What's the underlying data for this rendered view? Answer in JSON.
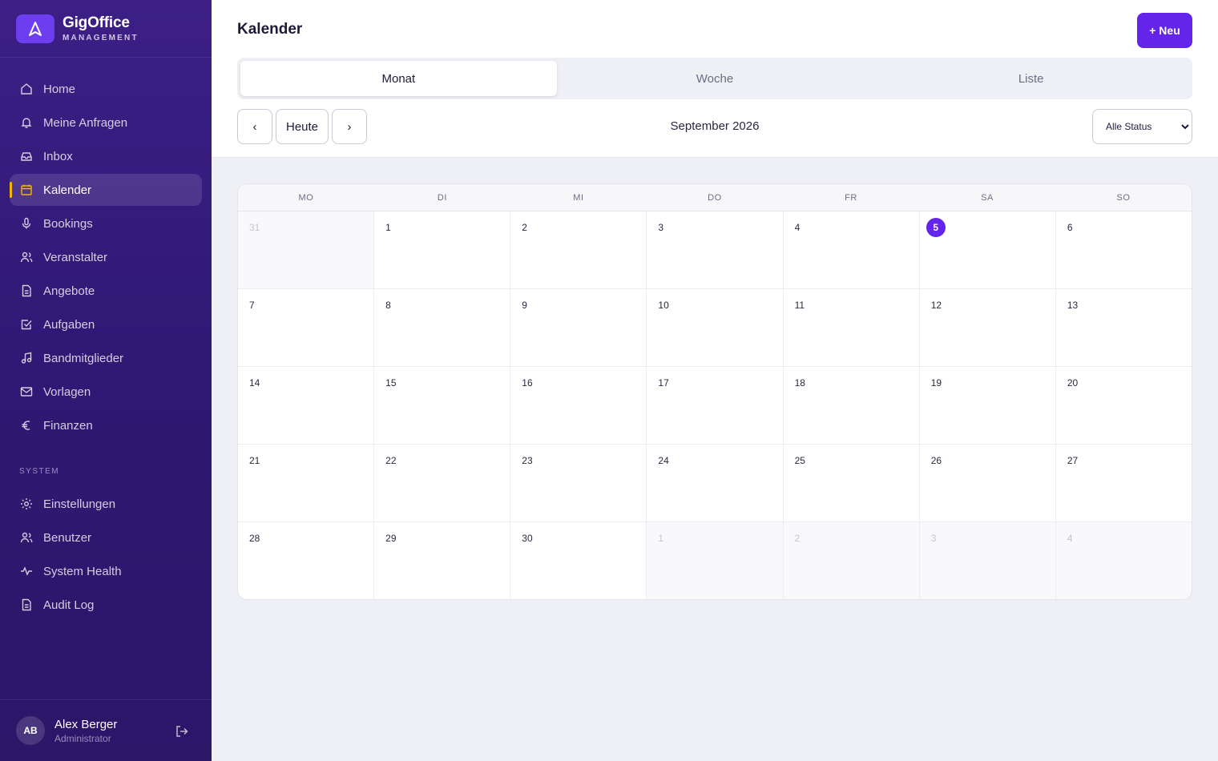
{
  "brand": {
    "name": "GigOffice",
    "subtitle": "MANAGEMENT"
  },
  "sidebar": {
    "items": [
      {
        "label": "Home",
        "icon": "home-icon",
        "active": false
      },
      {
        "label": "Meine Anfragen",
        "icon": "bell-icon",
        "active": false
      },
      {
        "label": "Inbox",
        "icon": "inbox-icon",
        "active": false
      },
      {
        "label": "Kalender",
        "icon": "calendar-icon",
        "active": true
      },
      {
        "label": "Bookings",
        "icon": "microphone-icon",
        "active": false
      },
      {
        "label": "Veranstalter",
        "icon": "users-icon",
        "active": false
      },
      {
        "label": "Angebote",
        "icon": "document-icon",
        "active": false
      },
      {
        "label": "Aufgaben",
        "icon": "checkbox-icon",
        "active": false
      },
      {
        "label": "Bandmitglieder",
        "icon": "music-note-icon",
        "active": false
      },
      {
        "label": "Vorlagen",
        "icon": "mail-icon",
        "active": false
      },
      {
        "label": "Finanzen",
        "icon": "euro-icon",
        "active": false
      }
    ],
    "system_label": "SYSTEM",
    "system_items": [
      {
        "label": "Einstellungen",
        "icon": "gear-icon"
      },
      {
        "label": "Benutzer",
        "icon": "users-icon"
      },
      {
        "label": "System Health",
        "icon": "pulse-icon"
      },
      {
        "label": "Audit Log",
        "icon": "document-icon"
      }
    ]
  },
  "user": {
    "initials": "AB",
    "name": "Alex Berger",
    "role": "Administrator"
  },
  "header": {
    "title": "Kalender",
    "new_button": "+ Neu"
  },
  "tabs": [
    {
      "label": "Monat",
      "active": true
    },
    {
      "label": "Woche",
      "active": false
    },
    {
      "label": "Liste",
      "active": false
    }
  ],
  "toolbar": {
    "prev": "‹",
    "today": "Heute",
    "next": "›",
    "month": "September 2026",
    "status_filter": "Alle Status"
  },
  "calendar": {
    "weekdays": [
      "MO",
      "DI",
      "MI",
      "DO",
      "FR",
      "SA",
      "SO"
    ],
    "today": 5,
    "weeks": [
      [
        {
          "d": "31",
          "out": true
        },
        {
          "d": "1"
        },
        {
          "d": "2"
        },
        {
          "d": "3"
        },
        {
          "d": "4"
        },
        {
          "d": "5",
          "today": true
        },
        {
          "d": "6"
        }
      ],
      [
        {
          "d": "7"
        },
        {
          "d": "8"
        },
        {
          "d": "9"
        },
        {
          "d": "10"
        },
        {
          "d": "11"
        },
        {
          "d": "12"
        },
        {
          "d": "13"
        }
      ],
      [
        {
          "d": "14"
        },
        {
          "d": "15"
        },
        {
          "d": "16"
        },
        {
          "d": "17"
        },
        {
          "d": "18"
        },
        {
          "d": "19"
        },
        {
          "d": "20"
        }
      ],
      [
        {
          "d": "21"
        },
        {
          "d": "22"
        },
        {
          "d": "23"
        },
        {
          "d": "24"
        },
        {
          "d": "25"
        },
        {
          "d": "26"
        },
        {
          "d": "27"
        }
      ],
      [
        {
          "d": "28"
        },
        {
          "d": "29"
        },
        {
          "d": "30"
        },
        {
          "d": "1",
          "out": true
        },
        {
          "d": "2",
          "out": true
        },
        {
          "d": "3",
          "out": true
        },
        {
          "d": "4",
          "out": true
        }
      ]
    ]
  },
  "colors": {
    "accent": "#6524ea",
    "sidebar": "#301975",
    "active_indicator": "#f5b400"
  }
}
